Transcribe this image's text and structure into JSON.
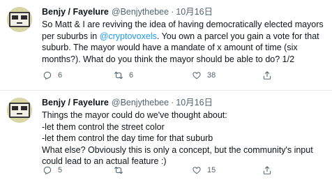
{
  "tweets": [
    {
      "author": "Benjy / Fayelure",
      "handle": "@Benjythebee",
      "separator": "·",
      "date": "10月16日",
      "text_before": "So Matt & I are reviving the idea of having democratically elected mayors per suburbs in ",
      "mention": "@cryptovoxels",
      "text_after": ". You own a parcel you gain a vote for that suburb. The mayor would have a mandate of x amount of time (six months?). What do you think the mayor should be able to do? 1/2",
      "replies": "6",
      "retweets": "6",
      "likes": "38"
    },
    {
      "author": "Benjy / Fayelure",
      "handle": "@Benjythebee",
      "separator": "·",
      "date": "10月16日",
      "text": "Things the mayor could do we've thought about:\n-let them control the street color\n-let them control the day time for that suburb\nWhat else? Obviously this is only a concept, but the community's input could lead to an actual feature :)",
      "replies": "5",
      "retweets": "",
      "likes": "15"
    }
  ],
  "icons": {
    "reply": "reply-icon",
    "retweet": "retweet-icon",
    "like": "heart-icon",
    "share": "share-icon"
  }
}
